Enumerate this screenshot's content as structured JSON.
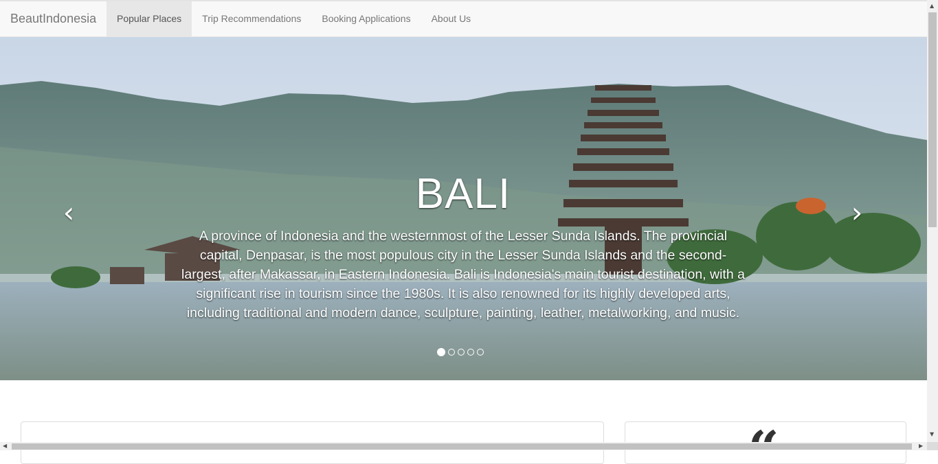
{
  "navbar": {
    "brand": "BeautIndonesia",
    "items": [
      {
        "label": "Popular Places",
        "active": true
      },
      {
        "label": "Trip Recommendations",
        "active": false
      },
      {
        "label": "Booking Applications",
        "active": false
      },
      {
        "label": "About Us",
        "active": false
      }
    ]
  },
  "carousel": {
    "title": "BALI",
    "description": "A province of Indonesia and the westernmost of the Lesser Sunda Islands. The provincial capital, Denpasar, is the most populous city in the Lesser Sunda Islands and the second-largest, after Makassar, in Eastern Indonesia. Bali is Indonesia's main tourist destination, with a significant rise in tourism since the 1980s. It is also renowned for its highly developed arts, including traditional and modern dance, sculpture, painting, leather, metalworking, and music.",
    "prev_glyph": "‹",
    "next_glyph": "›",
    "slide_count": 5,
    "active_slide": 1
  },
  "quote_glyph": "“",
  "icons": {
    "prev": "chevron-left-icon",
    "next": "chevron-right-icon"
  },
  "colors": {
    "navbar_bg": "#f8f8f8",
    "active_tab_bg": "#e7e7e7",
    "nav_text": "#777777"
  }
}
